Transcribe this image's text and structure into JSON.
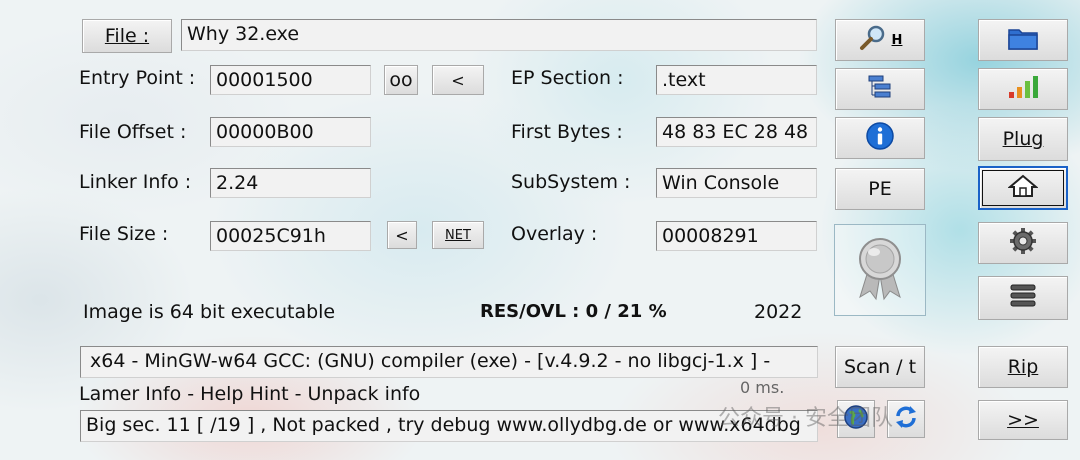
{
  "file": {
    "button_label": "File :",
    "path": "Why 32.exe"
  },
  "fields": {
    "entry_point_label": "Entry Point :",
    "entry_point_value": "00001500",
    "file_offset_label": "File Offset :",
    "file_offset_value": "00000B00",
    "linker_info_label": "Linker Info :",
    "linker_info_value": "2.24",
    "file_size_label": "File Size :",
    "file_size_value": "00025C91h",
    "ep_section_label": "EP Section :",
    "ep_section_value": ".text",
    "first_bytes_label": "First Bytes :",
    "first_bytes_value": "48 83 EC 28 48",
    "subsystem_label": "SubSystem :",
    "subsystem_value": "Win Console",
    "overlay_label": "Overlay :",
    "overlay_value": "00008291"
  },
  "small_buttons": {
    "oo": "oo",
    "lt_entry": "<",
    "lt_size": "<",
    "net": "NET"
  },
  "status": {
    "image_info": "Image is 64 bit executable",
    "res_ovl": "RES/OVL : 0 / 21 %",
    "year": "2022"
  },
  "detection": {
    "result": "x64 - MinGW-w64 GCC: (GNU) compiler (exe) - [v.4.9.2  - no  libgcj-1.x ]  -",
    "lamer_info": "Lamer Info - Help Hint - Unpack info",
    "time": "0 ms.",
    "hint": "Big sec. 11 [ /19 ] , Not packed , try debug www.ollydbg.de or www.x64dbg"
  },
  "side_buttons": {
    "search_h": "H",
    "pe": "PE",
    "scan": "Scan / t",
    "plug": "Plug",
    "rip": "Rip",
    "next": ">>"
  },
  "watermark": "公众号 · 安全团队",
  "colors": {
    "info_blue": "#1f6fd6",
    "folder_blue": "#2f6fd0",
    "selected_border": "#1a62c8"
  }
}
